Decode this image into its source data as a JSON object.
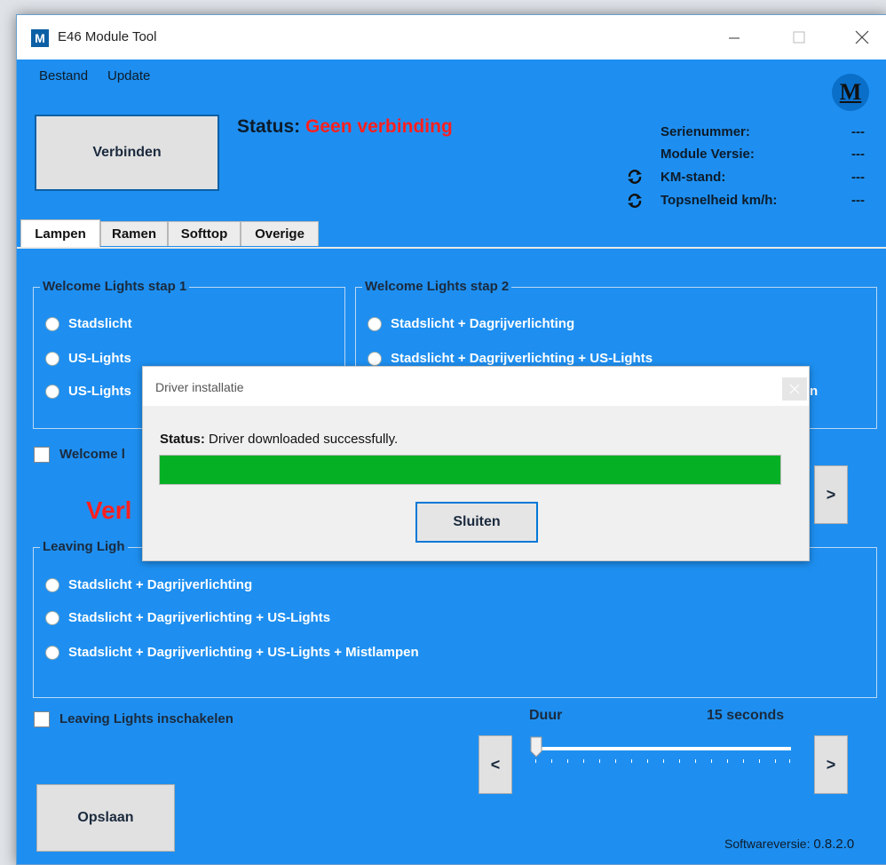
{
  "window": {
    "title": "E46 Module Tool",
    "app_icon_letter": "M",
    "logo_letter": "M"
  },
  "menu": {
    "items": [
      "Bestand",
      "Update"
    ]
  },
  "connect_button": "Verbinden",
  "status": {
    "label": "Status:",
    "value": "Geen verbinding",
    "value_color": "#ff1f1f"
  },
  "info": [
    {
      "label": "Serienummer:",
      "value": "---",
      "refresh": false
    },
    {
      "label": "Module Versie:",
      "value": "---",
      "refresh": false
    },
    {
      "label": "KM-stand:",
      "value": "---",
      "refresh": true
    },
    {
      "label": "Topsnelheid km/h:",
      "value": "---",
      "refresh": true
    }
  ],
  "tabs": [
    {
      "label": "Lampen",
      "active": true
    },
    {
      "label": "Ramen",
      "active": false
    },
    {
      "label": "Softtop",
      "active": false
    },
    {
      "label": "Overige",
      "active": false
    }
  ],
  "welcome1": {
    "legend": "Welcome Lights stap 1",
    "options": [
      "Stadslicht",
      "US-Lights",
      "US-Lights"
    ]
  },
  "welcome2": {
    "legend": "Welcome Lights stap 2",
    "options": [
      "Stadslicht + Dagrijverlichting",
      "Stadslicht + Dagrijverlichting + US-Lights",
      "n"
    ]
  },
  "welcome_enable_label": "Welcome l",
  "warning_text": "Verl",
  "leaving": {
    "legend": "Leaving Ligh",
    "options": [
      "Stadslicht + Dagrijverlichting",
      "Stadslicht + Dagrijverlichting + US-Lights",
      "Stadslicht + Dagrijverlichting + US-Lights + Mistlampen"
    ]
  },
  "leaving_enable_label": "Leaving Lights inschakelen",
  "duration": {
    "label": "Duur",
    "value_text": "15 seconds",
    "slider_fraction": 0.0
  },
  "nav": {
    "prev": "<",
    "next": ">"
  },
  "save_button": "Opslaan",
  "software_version": {
    "label": "Softwareversie:",
    "value": "0.8.2.0"
  },
  "dialog": {
    "title": "Driver installatie",
    "status_label": "Status:",
    "status_text": "Driver downloaded successfully.",
    "progress": 1.0,
    "progress_color": "#06b025",
    "close_button": "Sluiten"
  }
}
